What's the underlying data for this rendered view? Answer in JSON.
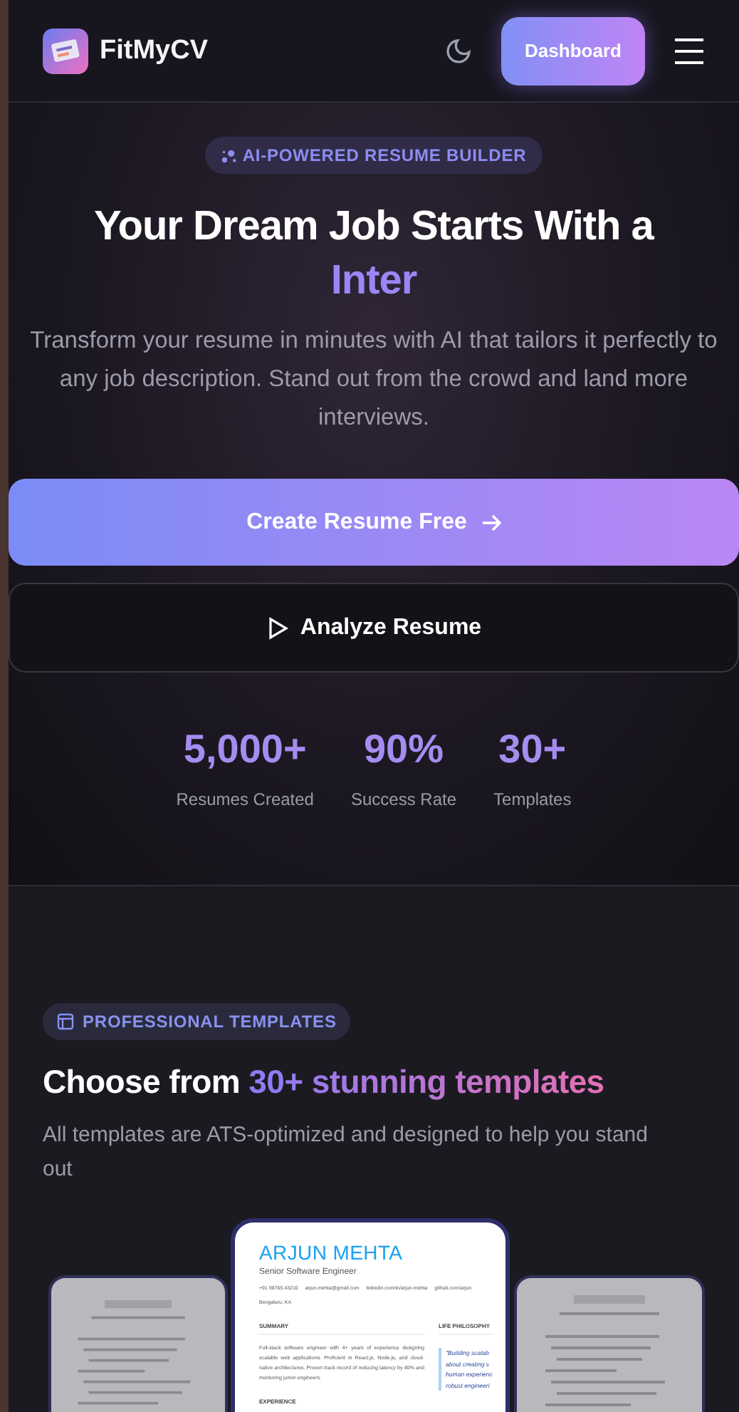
{
  "header": {
    "brand": "FitMyCV",
    "dashboard_button": "Dashboard"
  },
  "hero": {
    "badge": "AI-POWERED RESUME BUILDER",
    "title": "Your Dream Job Starts With a",
    "title_highlight": "Inter",
    "subtitle": "Transform your resume in minutes with AI that tailors it perfectly to any job description. Stand out from the crowd and land more interviews.",
    "primary_button": "Create Resume Free",
    "secondary_button": "Analyze Resume",
    "stats": [
      {
        "value": "5,000+",
        "label": "Resumes Created"
      },
      {
        "value": "90%",
        "label": "Success Rate"
      },
      {
        "value": "30+",
        "label": "Templates"
      }
    ]
  },
  "templates": {
    "badge": "PROFESSIONAL TEMPLATES",
    "title": "Choose from",
    "title_highlight": "30+ stunning templates",
    "subtitle": "All templates are ATS-optimized and designed to help you stand out",
    "preview": {
      "name": "ARJUN MEHTA",
      "role": "Senior Software Engineer",
      "contacts": [
        "+91 98765 43210",
        "arjun.mehta@gmail.com",
        "linkedin.com/in/arjun-mehta",
        "github.com/arjun"
      ],
      "location": "Bengaluru, KA",
      "summary_heading": "SUMMARY",
      "summary": "Full-stack software engineer with 4+ years of experience designing scalable web applications. Proficient in React.js, Node.js, and cloud-native architectures. Proven track record of reducing latency by 40% and mentoring junior engineers.",
      "philosophy_heading": "LIFE PHILOSOPHY",
      "quote_lines": [
        "\"Building scalab",
        "about creating s",
        "human experienc",
        "robust engineeri"
      ],
      "experience_heading": "EXPERIENCE"
    }
  }
}
